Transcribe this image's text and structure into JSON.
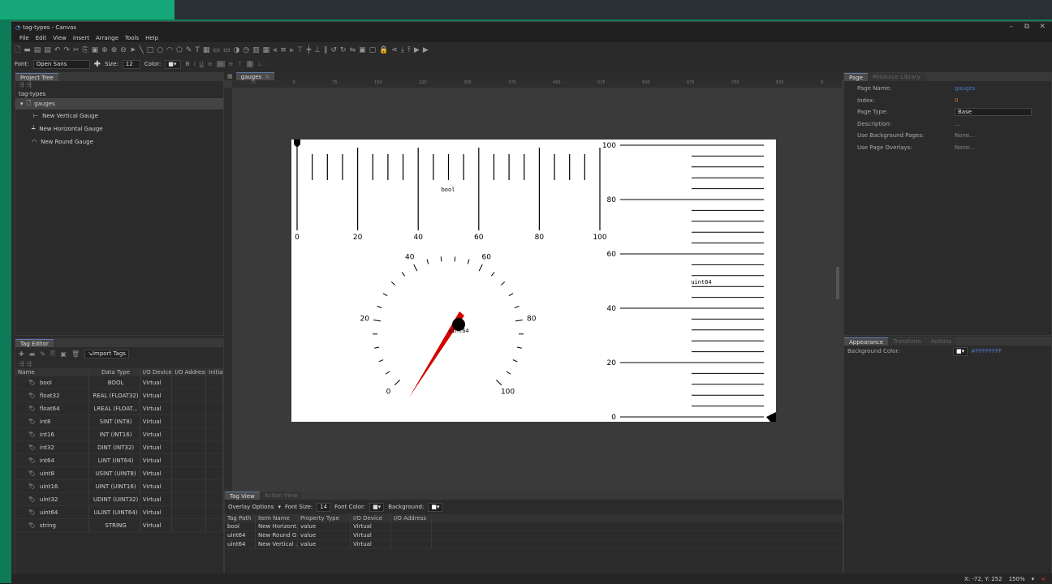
{
  "window": {
    "title": "tag-types - Canvas",
    "min": "–",
    "restore": "⧉",
    "close": "✕"
  },
  "menu": [
    "File",
    "Edit",
    "View",
    "Insert",
    "Arrange",
    "Tools",
    "Help"
  ],
  "format": {
    "font_label": "Font:",
    "font": "Open Sans",
    "size_label": "Size:",
    "size": "12",
    "color_label": "Color:"
  },
  "project_tree": {
    "tab": "Project Tree",
    "root": "tag-types",
    "page": "gauges",
    "items": [
      "New Vertical Gauge",
      "New Horizontal Gauge",
      "New Round Gauge"
    ]
  },
  "tag_editor": {
    "tab": "Tag Editor",
    "import": "Import Tags",
    "columns": [
      "Name",
      "Data Type",
      "I/O Device",
      "I/O Address",
      "Initial Valu"
    ],
    "rows": [
      [
        "bool",
        "BOOL",
        "Virtual"
      ],
      [
        "float32",
        "REAL (FLOAT32)",
        "Virtual"
      ],
      [
        "float64",
        "LREAL (FLOAT...",
        "Virtual"
      ],
      [
        "int8",
        "SINT (INT8)",
        "Virtual"
      ],
      [
        "int16",
        "INT (INT16)",
        "Virtual"
      ],
      [
        "int32",
        "DINT (INT32)",
        "Virtual"
      ],
      [
        "int64",
        "LINT (INT64)",
        "Virtual"
      ],
      [
        "uint8",
        "USINT (UINT8)",
        "Virtual"
      ],
      [
        "uint16",
        "UINT (UINT16)",
        "Virtual"
      ],
      [
        "uint32",
        "UDINT (UINT32)",
        "Virtual"
      ],
      [
        "uint64",
        "ULINT (UINT64)",
        "Virtual"
      ],
      [
        "string",
        "STRING",
        "Virtual"
      ]
    ]
  },
  "canvas": {
    "tab": "gauges",
    "ruler": [
      "75",
      "0",
      "75",
      "150",
      "225",
      "300",
      "375",
      "450",
      "525",
      "600",
      "675",
      "750",
      "825",
      "9"
    ]
  },
  "gauges": {
    "horizontal": {
      "tag": "bool",
      "labels": [
        "0",
        "20",
        "40",
        "60",
        "80",
        "100"
      ]
    },
    "round": {
      "tag": "uint64",
      "labels": [
        "0",
        "20",
        "40",
        "60",
        "80",
        "100"
      ]
    },
    "vertical": {
      "tag": "uint64",
      "labels": [
        "100",
        "80",
        "60",
        "40",
        "20",
        "0"
      ]
    }
  },
  "tag_view": {
    "tab": "Tag View",
    "tab2": "Action View",
    "overlay": "Overlay Options",
    "font_size_label": "Font Size:",
    "font_size": "14",
    "font_color_label": "Font Color:",
    "background_label": "Background:",
    "columns": [
      "Tag Path",
      "Item Name",
      "Property Type",
      "I/O Device",
      "I/O Address"
    ],
    "rows": [
      [
        "bool",
        "New Horizont...",
        "value",
        "Virtual"
      ],
      [
        "uint64",
        "New Round G...",
        "value",
        "Virtual"
      ],
      [
        "uint64",
        "New Vertical ...",
        "value",
        "Virtual"
      ]
    ]
  },
  "page_props": {
    "tab": "Page",
    "tab2": "Resource Library",
    "props": [
      [
        "Page Name:",
        "gauges"
      ],
      [
        "Index:",
        "0"
      ],
      [
        "Page Type:",
        "Base"
      ],
      [
        "Description:",
        "..."
      ],
      [
        "Use Background Pages:",
        "None..."
      ],
      [
        "Use Page Overlays:",
        "None..."
      ]
    ]
  },
  "appearance": {
    "tab": "Appearance",
    "tab2": "Transform",
    "tab3": "Actions",
    "bg_label": "Background Color:",
    "bg_value": "#FFFFFFFF"
  },
  "status": {
    "coords": "X: -72, Y: 252",
    "zoom": "150%"
  }
}
